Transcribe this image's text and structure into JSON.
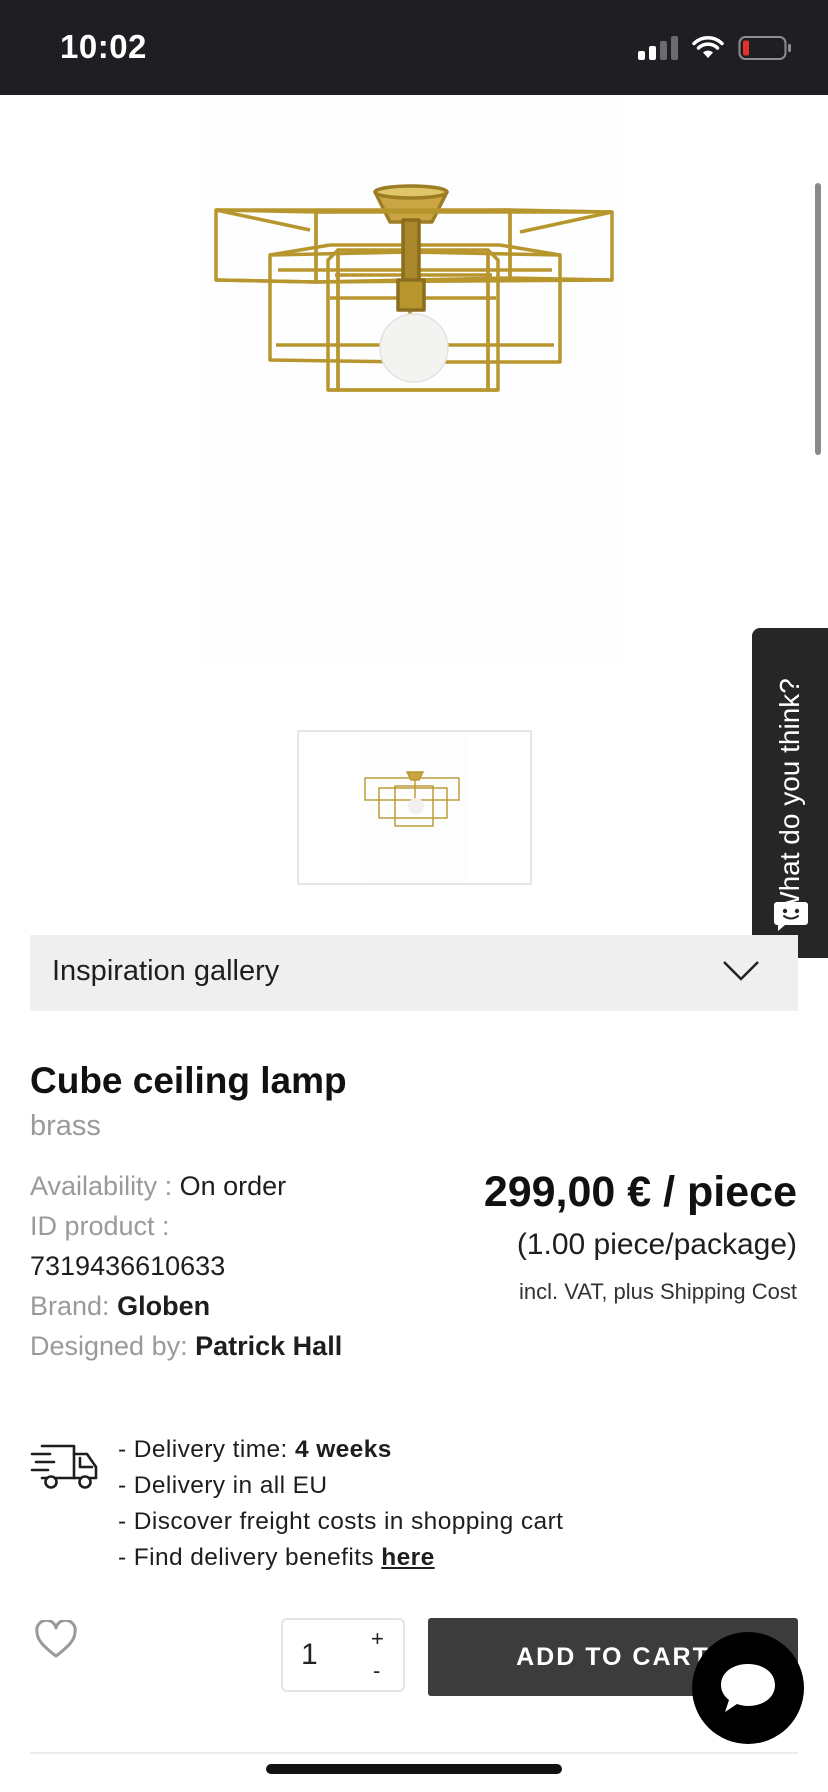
{
  "status_bar": {
    "time": "10:02",
    "icons": [
      "cellular-signal-icon",
      "wifi-icon",
      "battery-low-icon"
    ]
  },
  "product_image": {
    "subject": "brass-cube-ceiling-lamp",
    "thumbnail_count": 1
  },
  "feedback_tab": {
    "label": "What do you think?"
  },
  "inspiration": {
    "label": "Inspiration gallery"
  },
  "product": {
    "title": "Cube ceiling lamp",
    "variant": "brass",
    "availability_label": "Availability :",
    "availability_value": "On order",
    "id_label": "ID product :",
    "id_value": "7319436610633",
    "brand_label": "Brand:",
    "brand_value": "Globen",
    "designer_label": "Designed by:",
    "designer_value": "Patrick Hall",
    "price": "299,00 € / piece",
    "per_package": "(1.00 piece/package)",
    "vat_note": "incl. VAT, plus Shipping Cost"
  },
  "delivery": {
    "time_prefix": "- Delivery time: ",
    "time_value": "4 weeks",
    "line2": "- Delivery in all EU",
    "line3": "- Discover freight costs in shopping cart",
    "line4_prefix": "- Find delivery benefits ",
    "line4_link": "here"
  },
  "cart": {
    "quantity": "1",
    "plus": "+",
    "minus": "-",
    "add_to_cart": "ADD TO CART"
  },
  "colors": {
    "status_bar_bg": "#1f1f23",
    "brass": "#b8962e",
    "button_dark": "#3c3c3c",
    "accordion_bg": "#efefef",
    "muted_text": "#9a9a9a"
  }
}
